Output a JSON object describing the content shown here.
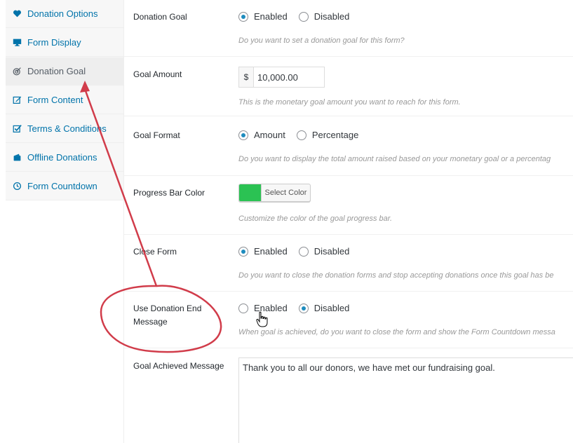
{
  "sidebar": {
    "items": [
      {
        "label": "Donation Options",
        "icon": "heart-icon"
      },
      {
        "label": "Form Display",
        "icon": "desktop-icon"
      },
      {
        "label": "Donation Goal",
        "icon": "target-icon",
        "active": true
      },
      {
        "label": "Form Content",
        "icon": "edit-icon"
      },
      {
        "label": "Terms & Conditions",
        "icon": "checkbox-icon"
      },
      {
        "label": "Offline Donations",
        "icon": "wallet-icon"
      },
      {
        "label": "Form Countdown",
        "icon": "clock-icon"
      }
    ]
  },
  "rows": {
    "donation_goal": {
      "label": "Donation Goal",
      "options": [
        "Enabled",
        "Disabled"
      ],
      "selected": "Enabled",
      "desc": "Do you want to set a donation goal for this form?"
    },
    "goal_amount": {
      "label": "Goal Amount",
      "currency": "$",
      "value": "10,000.00",
      "desc": "This is the monetary goal amount you want to reach for this form."
    },
    "goal_format": {
      "label": "Goal Format",
      "options": [
        "Amount",
        "Percentage"
      ],
      "selected": "Amount",
      "desc": "Do you want to display the total amount raised based on your monetary goal or a percentag"
    },
    "progress_bar_color": {
      "label": "Progress Bar Color",
      "button": "Select Color",
      "color": "#2bc253",
      "desc": "Customize the color of the goal progress bar."
    },
    "close_form": {
      "label": "Close Form",
      "options": [
        "Enabled",
        "Disabled"
      ],
      "selected": "Enabled",
      "desc": "Do you want to close the donation forms and stop accepting donations once this goal has be"
    },
    "use_end_message": {
      "label": "Use Donation End Message",
      "options": [
        "Enabled",
        "Disabled"
      ],
      "selected": "Disabled",
      "desc": "When goal is achieved, do you want to close the form and show the Form Countdown messa"
    },
    "goal_achieved_message": {
      "label": "Goal Achieved Message",
      "value": "Thank you to all our donors, we have met our fundraising goal."
    }
  },
  "colors": {
    "link": "#0073aa",
    "radio_checked": "#1e8cbe",
    "annotation": "#d13c4a"
  }
}
